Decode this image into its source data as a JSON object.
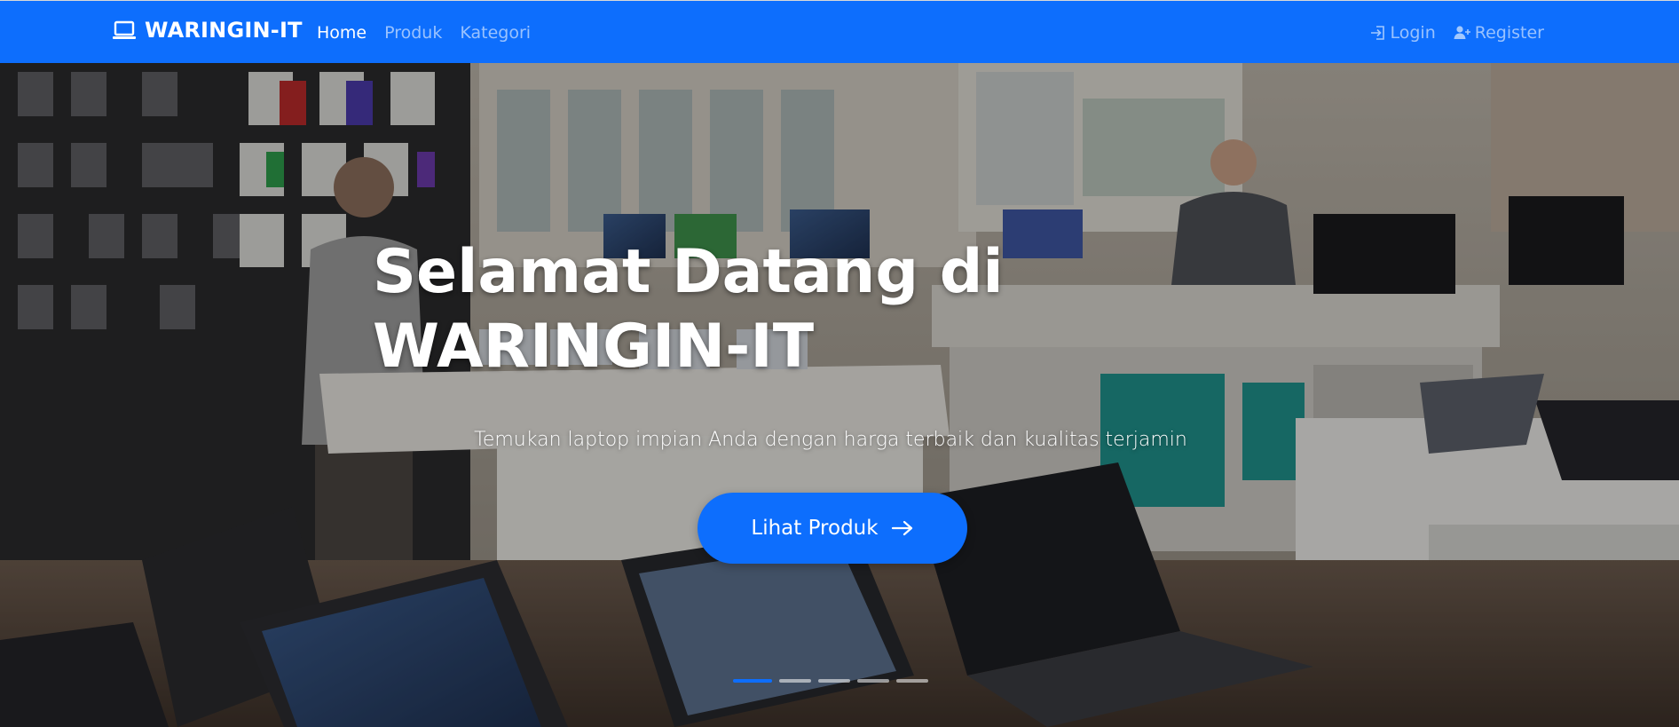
{
  "navbar": {
    "brand": "WARINGIN-IT",
    "links": [
      {
        "label": "Home",
        "active": true
      },
      {
        "label": "Produk",
        "active": false
      },
      {
        "label": "Kategori",
        "active": false
      }
    ],
    "login_label": "Login",
    "register_label": "Register",
    "bg_color": "#0d6efd"
  },
  "hero": {
    "title": "Selamat Datang di WARINGIN-IT",
    "subtitle": "Temukan laptop impian Anda dengan harga terbaik dan kualitas terjamin",
    "button_label": "Lihat Produk",
    "slides_count": 5,
    "active_slide": 1
  },
  "icons": {
    "brand": "laptop-icon",
    "login": "box-arrow-in-right-icon",
    "register": "person-plus-icon",
    "button": "arrow-right-icon"
  }
}
